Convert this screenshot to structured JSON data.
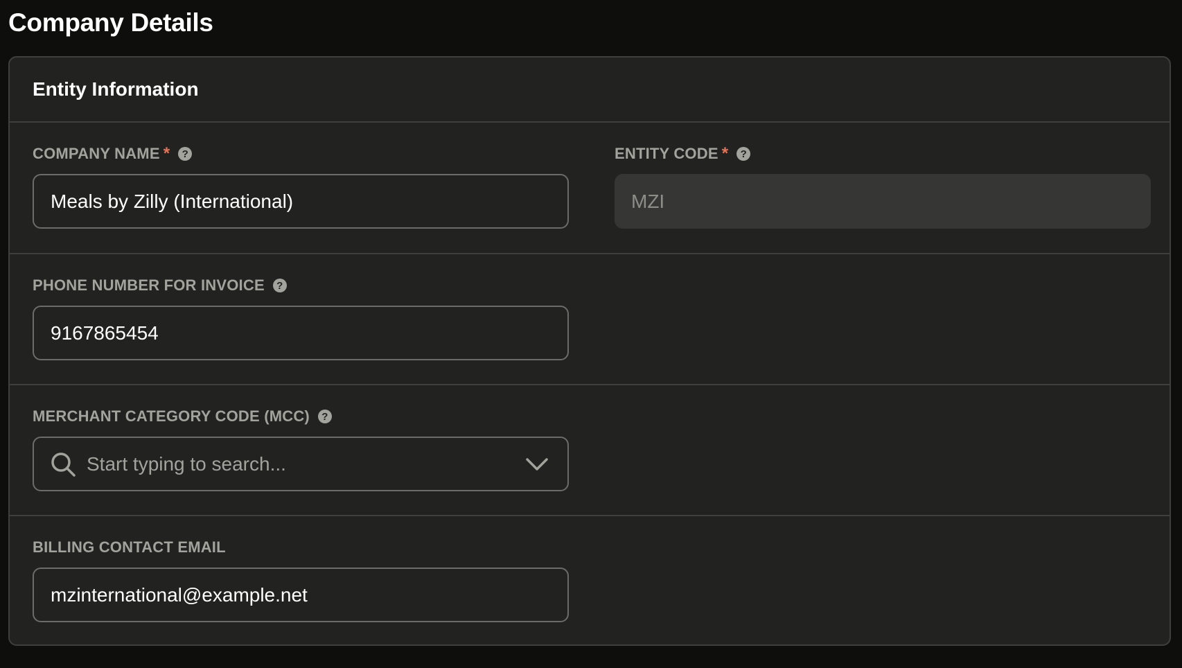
{
  "page": {
    "title": "Company Details"
  },
  "card": {
    "title": "Entity Information"
  },
  "fields": {
    "company_name": {
      "label": "COMPANY NAME",
      "required": "*",
      "value": "Meals by Zilly (International)"
    },
    "entity_code": {
      "label": "ENTITY CODE",
      "required": "*",
      "value": "MZI",
      "disabled": true
    },
    "phone": {
      "label": "PHONE NUMBER FOR INVOICE",
      "value": "9167865454"
    },
    "mcc": {
      "label": "MERCHANT CATEGORY CODE (MCC)",
      "placeholder": "Start typing to search..."
    },
    "billing_email": {
      "label": "BILLING CONTACT EMAIL",
      "value": "mzinternational@example.net"
    }
  },
  "icons": {
    "help": "help-circle-icon",
    "search": "search-icon",
    "dropdown": "chevron-down-icon"
  },
  "colors": {
    "background": "#0e0e0d",
    "card": "#222221",
    "border": "#3f3f3c",
    "label": "#a3a39d",
    "required": "#e2765a",
    "disabled_field": "#363634"
  }
}
